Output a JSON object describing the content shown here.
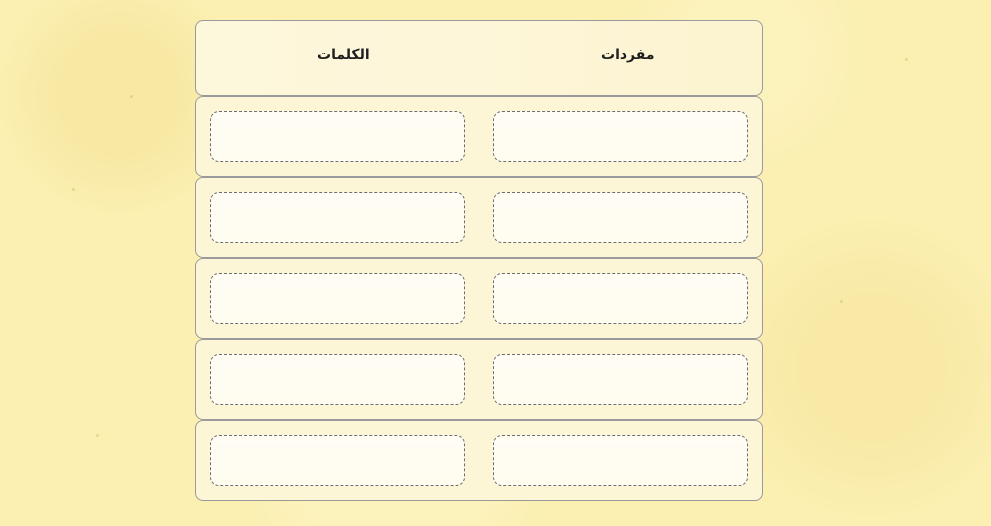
{
  "matching": {
    "headers": {
      "right": "مفردات",
      "left": "الكلمات"
    },
    "rows": [
      {
        "right_slot": "",
        "left_slot": ""
      },
      {
        "right_slot": "",
        "left_slot": ""
      },
      {
        "right_slot": "",
        "left_slot": ""
      },
      {
        "right_slot": "",
        "left_slot": ""
      },
      {
        "right_slot": "",
        "left_slot": ""
      }
    ]
  },
  "colors": {
    "background": "#fbefb1",
    "row_fill": "#fcf5d6",
    "slot_fill": "#fffdf4",
    "border": "#9a9a9a"
  }
}
